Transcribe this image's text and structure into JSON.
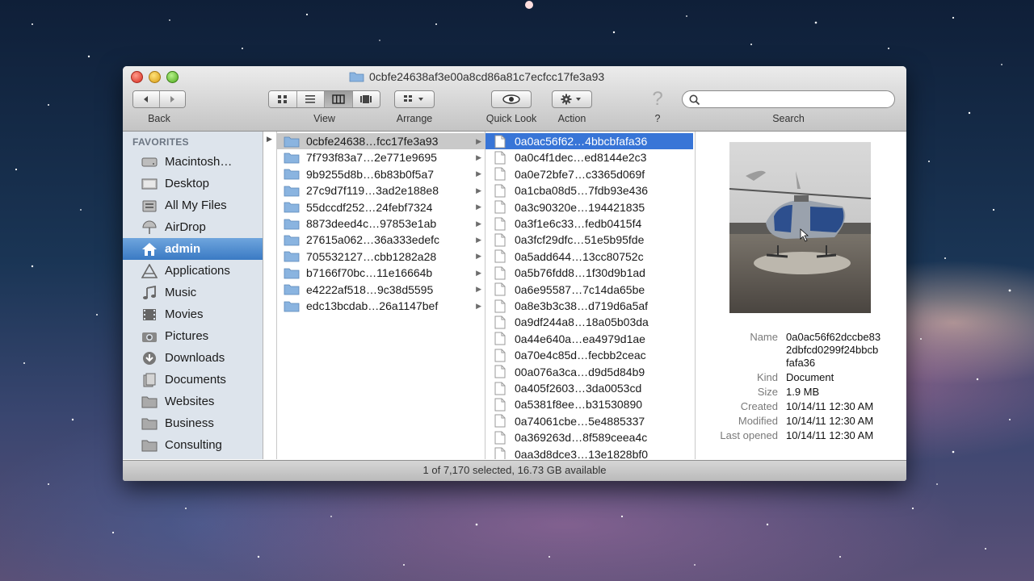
{
  "window": {
    "title": "0cbfe24638af3e00a8cd86a81c7ecfcc17fe3a93",
    "status": "1 of 7,170 selected, 16.73 GB available"
  },
  "toolbar": {
    "back_label": "Back",
    "view_label": "View",
    "arrange_label": "Arrange",
    "quicklook_label": "Quick Look",
    "action_label": "Action",
    "help_label": "?",
    "search_label": "Search",
    "search_placeholder": ""
  },
  "sidebar": {
    "heading": "FAVORITES",
    "items": [
      {
        "label": "Macintosh…",
        "icon": "hard-drive-icon"
      },
      {
        "label": "Desktop",
        "icon": "desktop-icon"
      },
      {
        "label": "All My Files",
        "icon": "all-files-icon"
      },
      {
        "label": "AirDrop",
        "icon": "airdrop-icon"
      },
      {
        "label": "admin",
        "icon": "home-icon"
      },
      {
        "label": "Applications",
        "icon": "applications-icon"
      },
      {
        "label": "Music",
        "icon": "music-icon"
      },
      {
        "label": "Movies",
        "icon": "movies-icon"
      },
      {
        "label": "Pictures",
        "icon": "camera-icon"
      },
      {
        "label": "Downloads",
        "icon": "downloads-icon"
      },
      {
        "label": "Documents",
        "icon": "documents-icon"
      },
      {
        "label": "Websites",
        "icon": "folder-icon"
      },
      {
        "label": "Business",
        "icon": "folder-icon"
      },
      {
        "label": "Consulting",
        "icon": "folder-icon"
      }
    ],
    "selected_index": 4
  },
  "column1": {
    "folders": [
      "0cbfe24638…fcc17fe3a93",
      "7f793f83a7…2e771e9695",
      "9b9255d8b…6b83b0f5a7",
      "27c9d7f119…3ad2e188e8",
      "55dccdf252…24febf7324",
      "8873deed4c…97853e1ab",
      "27615a062…36a333edefc",
      "705532127…cbb1282a28",
      "b7166f70bc…11e16664b",
      "e4222af518…9c38d5595",
      "edc13bcdab…26a1147bef"
    ],
    "selected_index": 0
  },
  "column2": {
    "files": [
      "0a0ac56f62…4bbcbfafa36",
      "0a0c4f1dec…ed8144e2c3",
      "0a0e72bfe7…c3365d069f",
      "0a1cba08d5…7fdb93e436",
      "0a3c90320e…194421835",
      "0a3f1e6c33…fedb0415f4",
      "0a3fcf29dfc…51e5b95fde",
      "0a5add644…13cc80752c",
      "0a5b76fdd8…1f30d9b1ad",
      "0a6e95587…7c14da65be",
      "0a8e3b3c38…d719d6a5af",
      "0a9df244a8…18a05b03da",
      "0a44e640a…ea4979d1ae",
      "0a70e4c85d…fecbb2ceac",
      "00a076a3ca…d9d5d84b9",
      "0a405f2603…3da0053cd",
      "0a5381f8ee…b31530890",
      "0a74061cbe…5e4885337",
      "0a369263d…8f589ceea4c",
      "0aa3d8dce3…13e1828bf0"
    ],
    "selected_index": 0
  },
  "preview": {
    "name_label": "Name",
    "name_value": [
      "0a0ac56f62dccbe83",
      "2dbfcd0299f24bbcb",
      "fafa36"
    ],
    "kind_label": "Kind",
    "kind_value": "Document",
    "size_label": "Size",
    "size_value": "1.9 MB",
    "created_label": "Created",
    "created_value": "10/14/11 12:30 AM",
    "modified_label": "Modified",
    "modified_value": "10/14/11 12:30 AM",
    "last_opened_label": "Last opened",
    "last_opened_value": "10/14/11 12:30 AM"
  },
  "colors": {
    "selection_blue": "#3875d7",
    "sidebar_bg": "#dde4ec",
    "sidebar_selected": "#3a7ac4"
  }
}
